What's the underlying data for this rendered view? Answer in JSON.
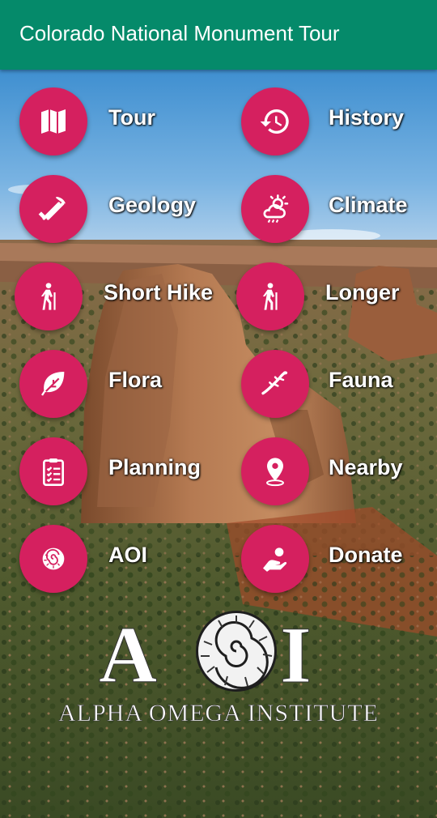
{
  "app_bar": {
    "title": "Colorado National Monument Tour"
  },
  "menu": {
    "tour": {
      "label": "Tour",
      "icon": "map-icon"
    },
    "history": {
      "label": "History",
      "icon": "history-icon"
    },
    "geology": {
      "label": "Geology",
      "icon": "pick-shovel-icon"
    },
    "climate": {
      "label": "Climate",
      "icon": "sun-cloud-icon"
    },
    "short_hike": {
      "label": "Short Hike",
      "icon": "hiker-icon"
    },
    "longer": {
      "label": "Longer",
      "icon": "hiker-icon"
    },
    "flora": {
      "label": "Flora",
      "icon": "leaf-icon"
    },
    "fauna": {
      "label": "Fauna",
      "icon": "lizard-icon"
    },
    "planning": {
      "label": "Planning",
      "icon": "checklist-icon"
    },
    "nearby": {
      "label": "Nearby",
      "icon": "location-pin-icon"
    },
    "aoi": {
      "label": "AOI",
      "icon": "ammonite-icon"
    },
    "donate": {
      "label": "Donate",
      "icon": "hand-coin-icon"
    }
  },
  "logo": {
    "letters": "AOI",
    "name": "ALPHA OMEGA INSTITUTE"
  },
  "colors": {
    "app_bar": "#058a6a",
    "button": "#d5205f",
    "label": "#ffffff"
  }
}
